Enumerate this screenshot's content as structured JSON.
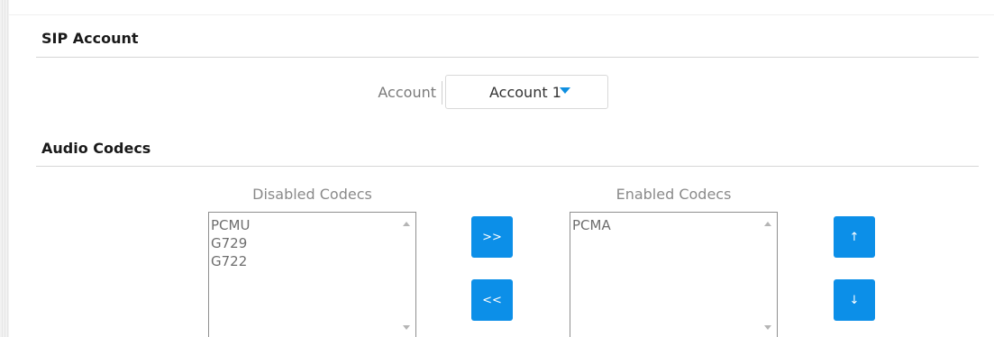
{
  "sip_account": {
    "title": "SIP Account",
    "account_label": "Account",
    "account_value": "Account 1"
  },
  "audio_codecs": {
    "title": "Audio Codecs",
    "disabled_caption": "Disabled Codecs",
    "enabled_caption": "Enabled Codecs",
    "disabled_list": [
      "PCMU",
      "G729",
      "G722"
    ],
    "enabled_list": [
      "PCMA"
    ],
    "move_right_label": ">>",
    "move_left_label": "<<",
    "move_up_label": "↑",
    "move_down_label": "↓"
  },
  "colors": {
    "accent": "#0c8fe8",
    "caret": "#0f8fe0"
  },
  "icons": {
    "dropdown": "caret-down-icon",
    "scroll_up": "scroll-up-icon",
    "scroll_down": "scroll-down-icon"
  }
}
